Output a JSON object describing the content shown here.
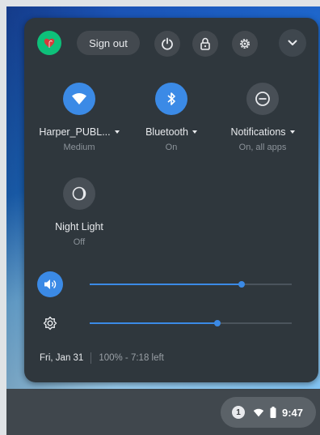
{
  "header": {
    "sign_out_label": "Sign out"
  },
  "toggles": [
    {
      "label": "Harper_PUBL...",
      "sub": "Medium",
      "icon": "wifi-icon",
      "state": "on"
    },
    {
      "label": "Bluetooth",
      "sub": "On",
      "icon": "bluetooth-icon",
      "state": "on"
    },
    {
      "label": "Notifications",
      "sub": "On, all apps",
      "icon": "do-not-disturb-icon",
      "state": "off"
    },
    {
      "label": "Night Light",
      "sub": "Off",
      "icon": "night-light-icon",
      "state": "off"
    }
  ],
  "sliders": {
    "volume": {
      "icon": "volume-icon",
      "level": 0.75
    },
    "brightness": {
      "icon": "brightness-icon",
      "level": 0.63
    }
  },
  "footer": {
    "date": "Fri, Jan 31",
    "battery": "100% - 7:18 left"
  },
  "tray": {
    "notification_count": "1",
    "time": "9:47"
  },
  "colors": {
    "accent": "#3b8ae6",
    "panel": "#2f373d"
  }
}
